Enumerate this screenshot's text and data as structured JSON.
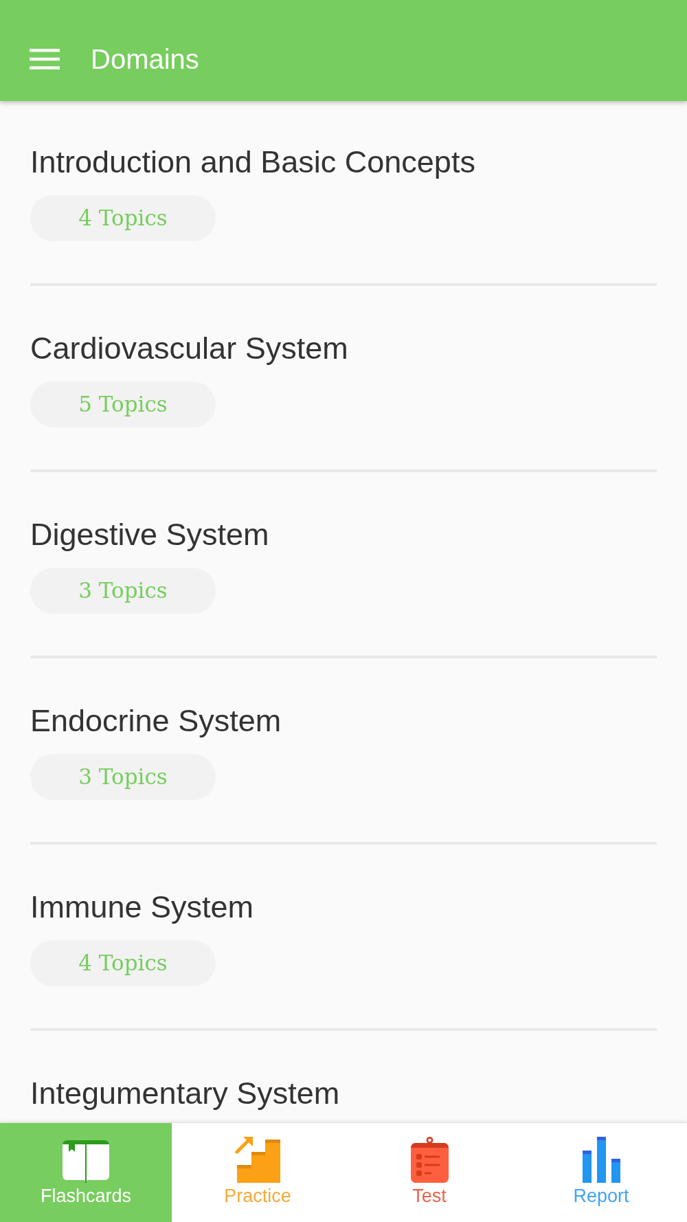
{
  "app_bar": {
    "title": "Domains"
  },
  "domains": [
    {
      "title": "Introduction and Basic Concepts",
      "topics": "4 Topics"
    },
    {
      "title": "Cardiovascular System",
      "topics": "5 Topics"
    },
    {
      "title": "Digestive System",
      "topics": "3 Topics"
    },
    {
      "title": "Endocrine System",
      "topics": "3 Topics"
    },
    {
      "title": "Immune System",
      "topics": "4 Topics"
    },
    {
      "title": "Integumentary System"
    }
  ],
  "bottom_nav": [
    {
      "label": "Flashcards",
      "kind": "flashcards",
      "selected": true
    },
    {
      "label": "Practice",
      "kind": "practice",
      "selected": false
    },
    {
      "label": "Test",
      "kind": "test",
      "selected": false
    },
    {
      "label": "Report",
      "kind": "report",
      "selected": false
    }
  ]
}
